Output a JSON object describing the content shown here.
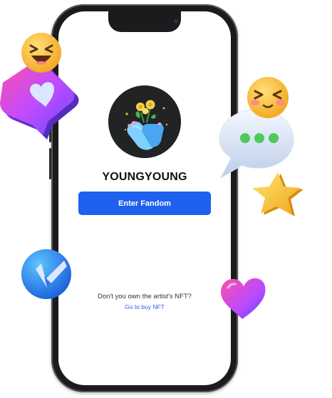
{
  "artist": {
    "name": "YOUNGYOUNG"
  },
  "actions": {
    "enter_label": "Enter Fandom"
  },
  "footer": {
    "question": "Don't you own the artist's NFT?",
    "buy_link": "Go to buy NFT"
  },
  "colors": {
    "primary": "#1f60ee",
    "link": "#2a62e6",
    "avatar_bg": "#222325"
  },
  "decorations": [
    "laughing-emoji",
    "heart-bubble",
    "chat-bubble",
    "star",
    "checkmark-badge",
    "heart"
  ]
}
